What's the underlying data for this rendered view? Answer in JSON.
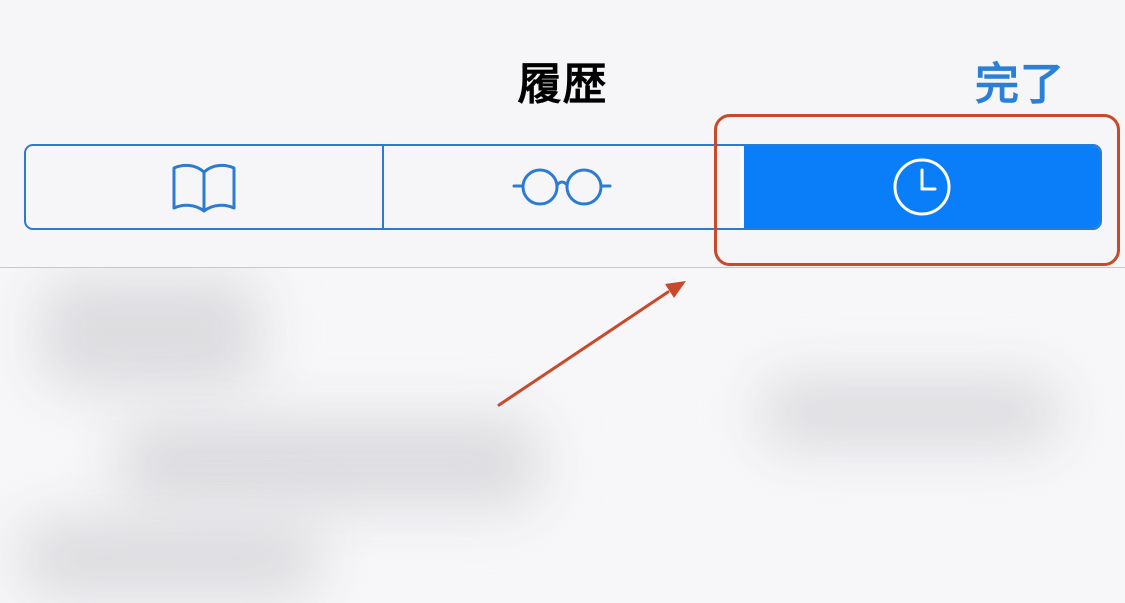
{
  "nav": {
    "title": "履歴",
    "done_label": "完了"
  },
  "segmented_control": {
    "segments": [
      {
        "name": "bookmarks",
        "icon": "book-icon",
        "selected": false
      },
      {
        "name": "reading-list",
        "icon": "glasses-icon",
        "selected": false
      },
      {
        "name": "history",
        "icon": "clock-icon",
        "selected": true
      }
    ]
  },
  "colors": {
    "accent": "#2c7bd3",
    "selected_fill": "#0a7ef8",
    "annotation": "#c94a2a"
  }
}
